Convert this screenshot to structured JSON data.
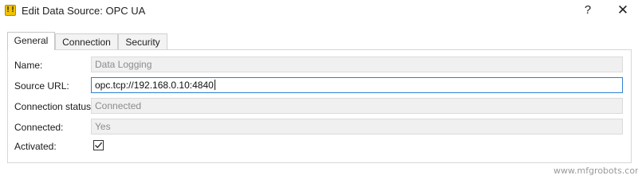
{
  "window": {
    "title": "Edit Data Source: OPC UA",
    "app_icon_glyph": "!!",
    "help_label": "?",
    "close_label": "✕"
  },
  "tabs": [
    {
      "label": "General",
      "active": true
    },
    {
      "label": "Connection",
      "active": false
    },
    {
      "label": "Security",
      "active": false
    }
  ],
  "form": {
    "name": {
      "label": "Name:",
      "value": "Data Logging"
    },
    "source_url": {
      "label": "Source URL:",
      "value": "opc.tcp://192.168.0.10:4840"
    },
    "connection_status": {
      "label": "Connection status:",
      "value": "Connected"
    },
    "connected": {
      "label": "Connected:",
      "value": "Yes"
    },
    "activated": {
      "label": "Activated:",
      "checked": true
    }
  },
  "watermark": "www.mfgrobots.com",
  "colors": {
    "accent": "#2f7fd6",
    "app_icon": "#f2c200",
    "readonly_field": "#f0f0f0"
  }
}
